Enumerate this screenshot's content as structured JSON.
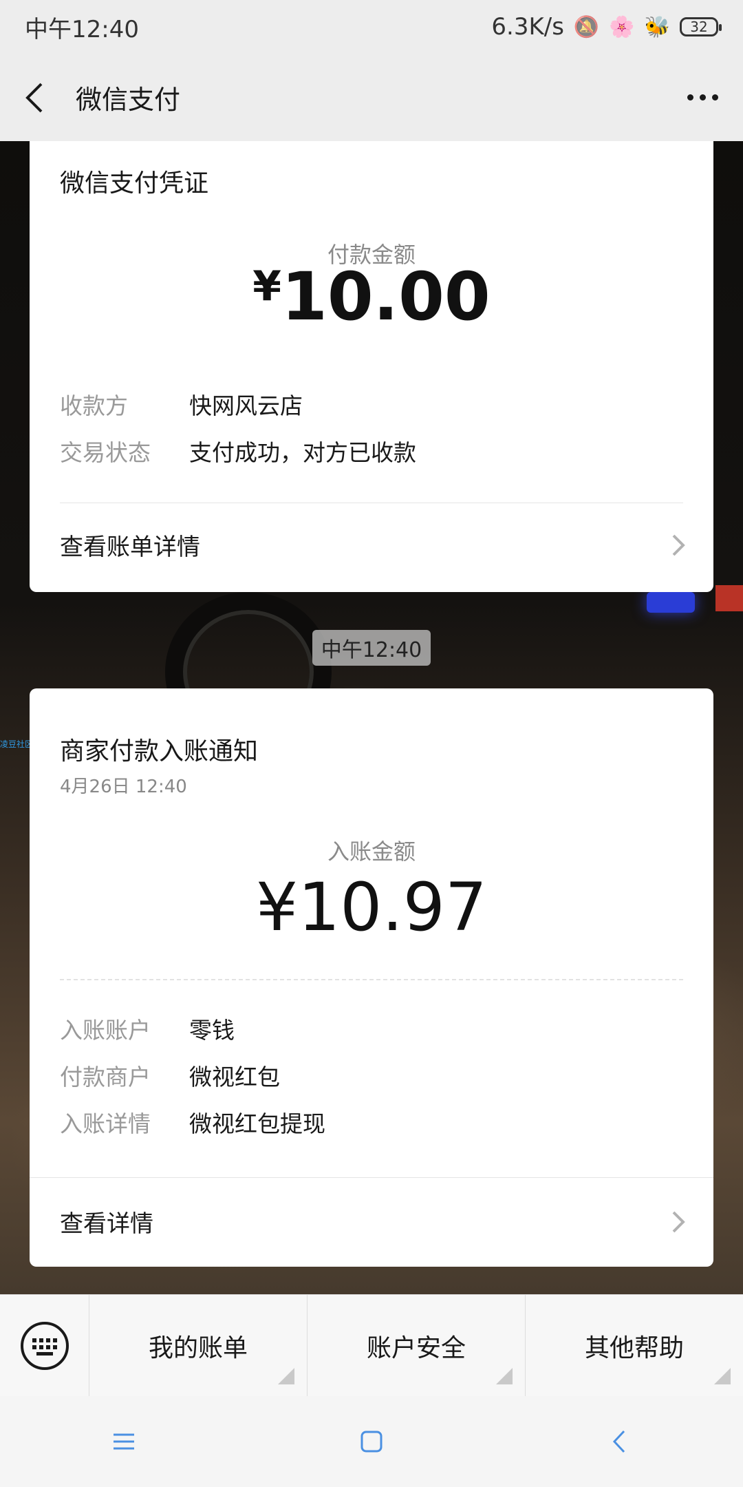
{
  "status_bar": {
    "time": "中午12:40",
    "network_speed": "6.3K/s",
    "battery": "32",
    "icons": [
      "bell-off-icon",
      "flower-icon",
      "bees-icon",
      "battery-icon"
    ]
  },
  "nav": {
    "title": "微信支付",
    "back_icon": "back-arrow-icon",
    "more_icon": "more-dots-icon"
  },
  "payment_card": {
    "title": "微信支付凭证",
    "amount_label": "付款金额",
    "currency": "¥",
    "amount": "10.00",
    "rows": [
      {
        "label": "收款方",
        "value": "快网风云店"
      },
      {
        "label": "交易状态",
        "value": "支付成功，对方已收款"
      }
    ],
    "link": "查看账单详情"
  },
  "chat_time": "中午12:40",
  "side_watermark": "凌豆社区",
  "income_card": {
    "title": "商家付款入账通知",
    "date": "4月26日  12:40",
    "amount_label": "入账金额",
    "currency": "¥",
    "amount": "10.97",
    "rows": [
      {
        "label": "入账账户",
        "value": "零钱"
      },
      {
        "label": "付款商户",
        "value": "微视红包"
      },
      {
        "label": "入账详情",
        "value": "微视红包提现"
      }
    ],
    "link": "查看详情"
  },
  "bottom_menu": {
    "keyboard_icon": "keyboard-icon",
    "items": [
      "我的账单",
      "账户安全",
      "其他帮助"
    ]
  },
  "system_nav": [
    "menu-icon",
    "home-icon",
    "back-icon"
  ],
  "colors": {
    "bar_bg": "#ededed",
    "card_bg": "#ffffff",
    "label_gray": "#999999",
    "text_dark": "#191919",
    "nav_icon_blue": "#4a90e2"
  }
}
